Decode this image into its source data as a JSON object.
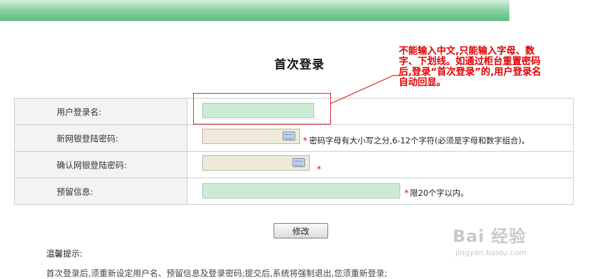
{
  "page_title": "首次登录",
  "fields": [
    {
      "label": "用户登录名:",
      "value": ""
    },
    {
      "label": "新网银登陆密码:",
      "value": "",
      "hint": "密码字母有大小写之分,6-12个字符(必须是字母和数字组合)。"
    },
    {
      "label": "确认网银登陆密码:",
      "value": ""
    },
    {
      "label": "预留信息:",
      "value": "",
      "hint": "限20个字以内。"
    }
  ],
  "required_mark": "*",
  "submit_label": "修改",
  "tips": {
    "title": "温馨提示:",
    "first_line": "首次登录后,须重新设定用户名、预留信息及登录密码;提交后,系统将强制退出,您须重新登录;"
  },
  "annotation": "不能输入中文,只能输入字母、数字、下划线。如通过柜台重置密码后,登录“首次登录”的,用户登录名自动回显。",
  "watermark": {
    "main": "Bai 经验",
    "sub": "jingyan.baidu.com"
  },
  "colors": {
    "banner": "#5bbd83",
    "input_green": "#cdebd3",
    "input_beige": "#eee9d9",
    "annotation_red": "#e00000"
  }
}
